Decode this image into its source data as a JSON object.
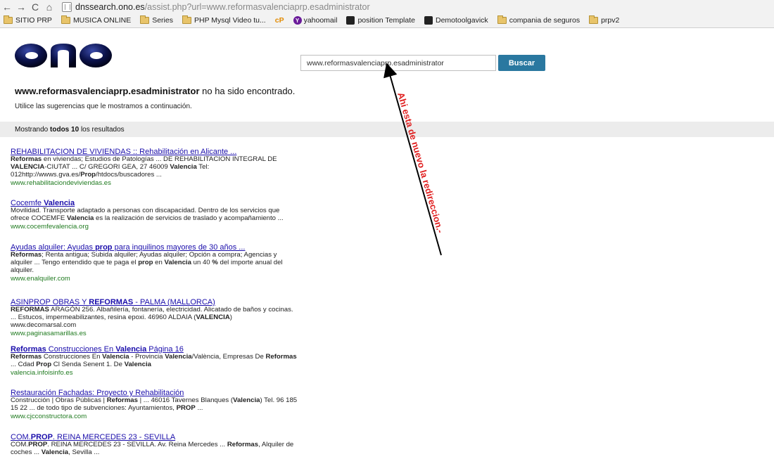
{
  "browser": {
    "nav_back": "←",
    "nav_forward": "→",
    "nav_reload": "C",
    "nav_home": "⌂",
    "url_host": "dnssearch.ono.es",
    "url_path": "/assist.php?url=www.reformasvalenciaprp.esadministrator"
  },
  "bookmarks": [
    {
      "label": "SITIO PRP",
      "icon": "folder-icon"
    },
    {
      "label": "MUSICA ONLINE",
      "icon": "folder-icon"
    },
    {
      "label": "Series",
      "icon": "folder-icon"
    },
    {
      "label": "PHP Mysql Video tu...",
      "icon": "folder-icon"
    },
    {
      "label": "cP",
      "icon": "cpanel-icon"
    },
    {
      "label": "yahoomail",
      "icon": "yahoo-icon"
    },
    {
      "label": "position Template",
      "icon": "joomla-icon"
    },
    {
      "label": "Demotoolgavick",
      "icon": "joomla-icon"
    },
    {
      "label": "compania de seguros",
      "icon": "folder-icon"
    },
    {
      "label": "prpv2",
      "icon": "folder-icon"
    }
  ],
  "search": {
    "query": "www.reformasvalenciaprp.esadministrator",
    "button_label": "Buscar"
  },
  "message": {
    "domain": "www.reformasvalenciaprp.esadministrator",
    "not_found": " no ha sido encontrado.",
    "suggest": "Utilice las sugerencias que le mostramos a continuación."
  },
  "results_bar": {
    "prefix": "Mostrando ",
    "bold": "todos 10",
    "suffix": " los resultados"
  },
  "annotation": {
    "text": "Ahi esta de nuevo la redireccion.-",
    "color": "#e02020"
  },
  "results": [
    {
      "title": "REHABILITACION DE VIVIENDAS :: Rehabilitación en Alicante ...",
      "snippet_html": "<b>Reformas</b> en viviendas; Estudios de Patologías ... DE REHABILITACION INTEGRAL DE <b>VALENCIA</b>-CIUTAT ... C/ GREGORI GEA, 27 46009 <b>Valencia</b> Tel: 012http://wwws.gva.es/<b>Prop</b>/htdocs/buscadores ...",
      "url": "www.rehabilitaciondeviviendas.es"
    },
    {
      "title_html": "Cocemfe <b>Valencia</b>",
      "snippet_html": "Movilidad. Transporte adaptado a personas con discapacidad. Dentro de los servicios que ofrece COCEMFE <b>Valencia</b> es la realización de servicios de traslado y acompañamiento ...",
      "url": "www.cocemfevalencia.org"
    },
    {
      "title_html": "Ayudas alquiler: Ayudas <b>prop</b> para inquilinos mayores de 30 años ...",
      "snippet_html": "<b>Reformas</b>; Renta antigua; Subida alquiler; Ayudas alquiler; Opción a compra; Agencias y alquiler ... Tengo entendido que te paga el <b>prop</b> en <b>Valencia</b> un 40 <b>%</b> del importe anual del alquiler.",
      "url": "www.enalquiler.com"
    },
    {
      "title_html": "ASINPROP OBRAS Y <b>REFORMAS</b> - PALMA (MALLORCA)",
      "snippet_html": "<b>REFORMAS</b> ARAGÓN 256. Albañilería, fontanería, electricidad. Alicatado de baños y cocinas. ... Estucos, impermeabilizantes, resina epoxi. 46960 ALDAIA (<b>VALENCIA</b>) www.decomarsal.com",
      "url": "www.paginasamarillas.es"
    },
    {
      "title_html": "<b>Reformas</b> Construcciones En <b>Valencia</b> Página 16",
      "snippet_html": "<b>Reformas</b> Construcciones En <b>Valencia</b> - Provincia <b>Valencia</b>/València, Empresas De <b>Reformas</b> ... Cdad <b>Prop</b> Cl Senda Senent 1. De <b>Valencia</b>",
      "url": "valencia.infoisinfo.es"
    },
    {
      "title": "Restauración Fachadas: Proyecto y Rehabilitación",
      "snippet_html": "Construcción | Obras Públicas | <b>Reformas</b> | ... 46016 Tavernes Blanques (<b>Valencia</b>) Tel. 96 185 15 22 ... de todo tipo de subvenciones: Ayuntamientos, <b>PROP</b> ...",
      "url": "www.cjcconstructora.com"
    },
    {
      "title_html": "COM.<b>PROP</b>. REINA MERCEDES 23 - SEVILLA",
      "snippet_html": "COM.<b>PROP</b>. REINA MERCEDES 23 - SEVILLA. Av. Reina Mercedes ... <b>Reformas</b>, Alquiler de coches ... <b>Valencia</b>, Sevilla ...",
      "url": ""
    }
  ]
}
